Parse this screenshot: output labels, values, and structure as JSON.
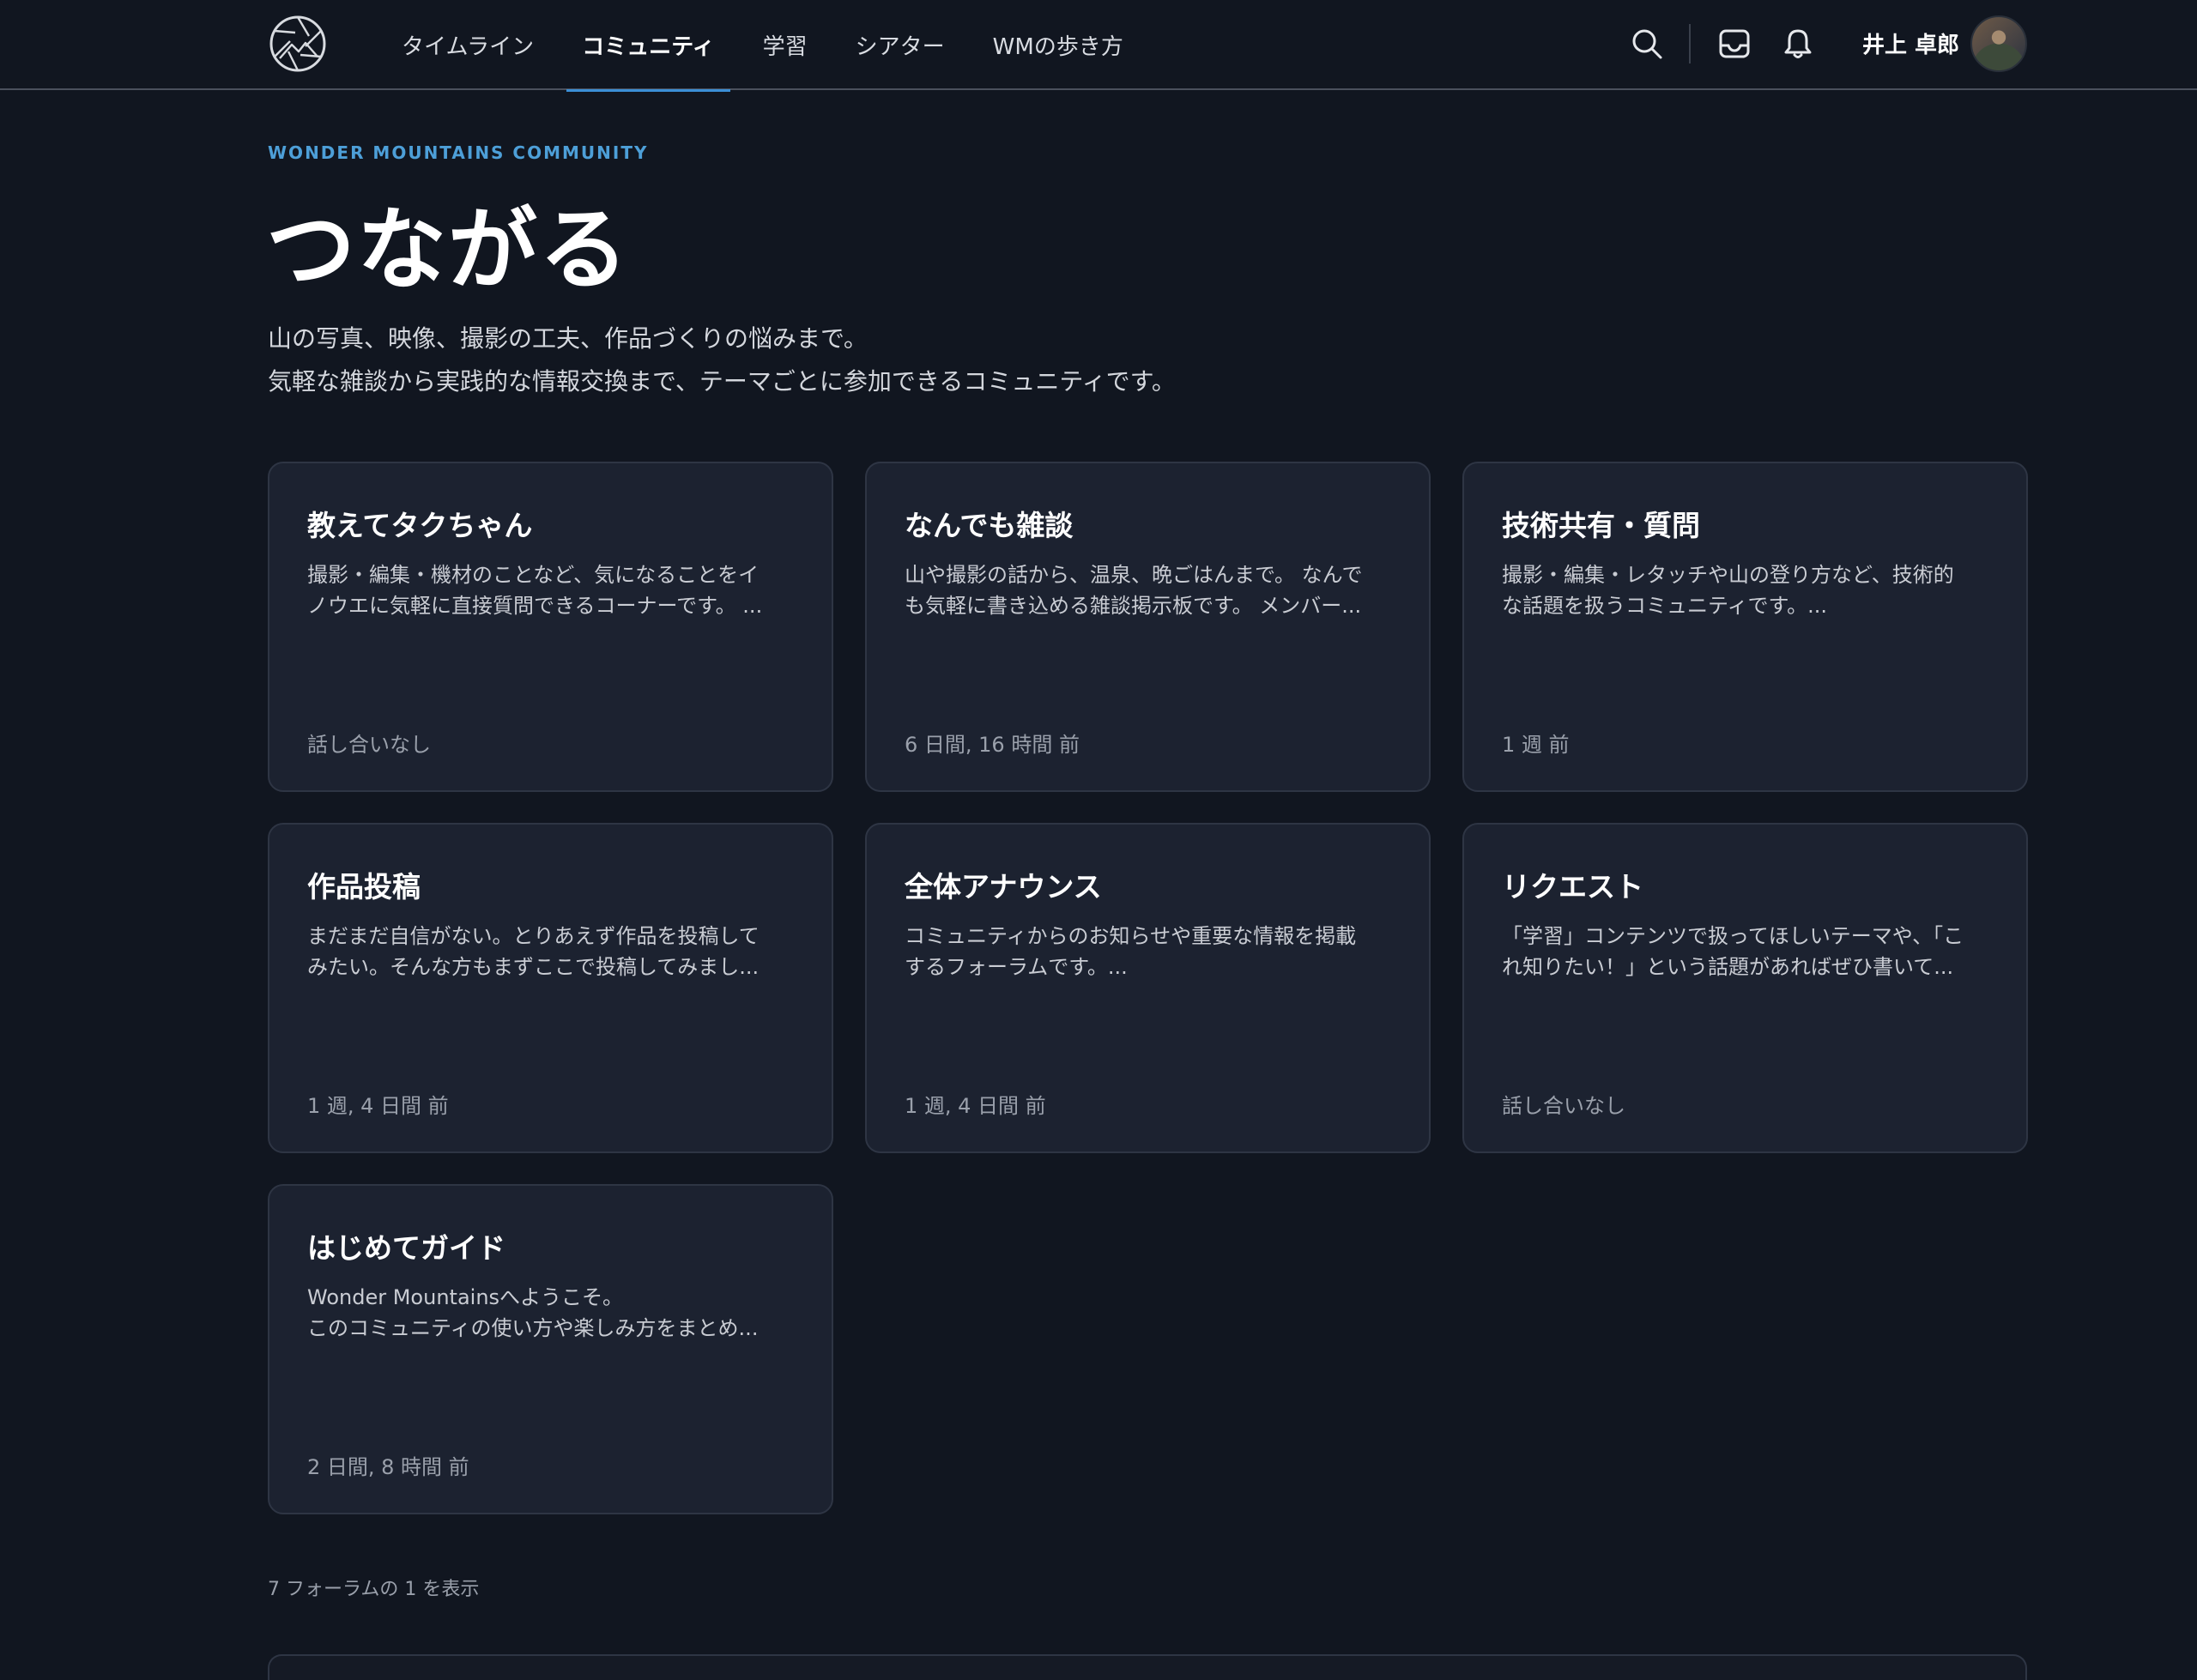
{
  "header": {
    "nav": [
      {
        "label": "タイムライン",
        "active": false
      },
      {
        "label": "コミュニティ",
        "active": true
      },
      {
        "label": "学習",
        "active": false
      },
      {
        "label": "シアター",
        "active": false
      },
      {
        "label": "WMの歩き方",
        "active": false
      }
    ],
    "icons": [
      "search-icon",
      "inbox-icon",
      "bell-icon"
    ],
    "user_name": "井上 卓郎"
  },
  "hero": {
    "eyebrow": "WONDER MOUNTAINS COMMUNITY",
    "title": "つながる",
    "description_line1": "山の写真、映像、撮影の工夫、作品づくりの悩みまで。",
    "description_line2": "気軽な雑談から実践的な情報交換まで、テーマごとに参加できるコミュニティです。"
  },
  "forums": [
    {
      "title": "教えてタクちゃん",
      "description": "撮影・編集・機材のことなど、気になることをイ\nノウエに気軽に直接質問できるコーナーです。 ...",
      "last_activity": "話し合いなし"
    },
    {
      "title": "なんでも雑談",
      "description": "山や撮影の話から、温泉、晩ごはんまで。 なんで\nも気軽に書き込める雑談掲示板です。 メンバー...",
      "last_activity": "6 日間, 16 時間 前"
    },
    {
      "title": "技術共有・質問",
      "description": "撮影・編集・レタッチや山の登り方など、技術的\nな話題を扱うコミュニティです。...",
      "last_activity": "1 週 前"
    },
    {
      "title": "作品投稿",
      "description": "まだまだ自信がない。とりあえず作品を投稿して\nみたい。そんな方もまずここで投稿してみまし...",
      "last_activity": "1 週, 4 日間 前"
    },
    {
      "title": "全体アナウンス",
      "description": "コミュニティからのお知らせや重要な情報を掲載\nするフォーラムです。...",
      "last_activity": "1 週, 4 日間 前"
    },
    {
      "title": "リクエスト",
      "description": "「学習」コンテンツで扱ってほしいテーマや、「こ\nれ知りたい！」という話題があればぜひ書いて...",
      "last_activity": "話し合いなし"
    },
    {
      "title": "はじめてガイド",
      "description": "Wonder Mountainsへようこそ。\nこのコミュニティの使い方や楽しみ方をまとめ...",
      "last_activity": "2 日間, 8 時間 前"
    }
  ],
  "pagination": {
    "text": "7 フォーラムの 1 を表示"
  },
  "colors": {
    "background": "#111620",
    "card": "#1c2230",
    "accent": "#3b8fd6"
  }
}
